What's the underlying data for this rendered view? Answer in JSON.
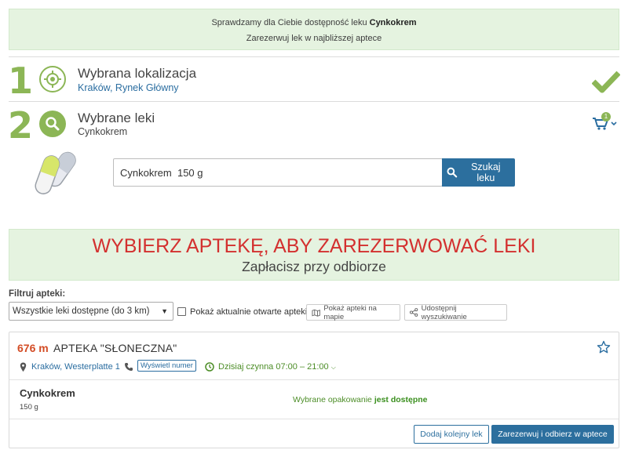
{
  "banner": {
    "line1_prefix": "Sprawdzamy dla Ciebie dostępność leku ",
    "line1_drug": "Cynkokrem",
    "line2": "Zarezerwuj lek w najbliższej aptece"
  },
  "steps": [
    {
      "number": "1",
      "title": "Wybrana lokalizacja",
      "subtitle": "Kraków, Rynek Główny",
      "icon": "crosshair-icon",
      "status_icon": "checkmark-icon"
    },
    {
      "number": "2",
      "title": "Wybrane leki",
      "subtitle": "Cynkokrem",
      "icon": "search-icon",
      "status_icon": "cart-icon",
      "cart_count": "1"
    }
  ],
  "search": {
    "value": "Cynkokrem  150 g",
    "button_label": "Szukaj leku"
  },
  "cta": {
    "headline": "WYBIERZ APTEKĘ, ABY ZAREZERWOWAĆ LEKI",
    "subline": "Zapłacisz przy odbiorze"
  },
  "filters": {
    "label": "Filtruj apteki:",
    "select_value": "Wszystkie leki dostępne (do 3 km)",
    "checkbox_label": "Pokaż aktualnie otwarte apteki",
    "map_button": "Pokaż apteki na mapie",
    "share_button": "Udostępnij wyszukiwanie"
  },
  "pharmacy": {
    "distance": "676 m",
    "name": "APTEKA \"SŁONECZNA\"",
    "address": "Kraków, Westerplatte 1",
    "phone_button": "Wyświetl numer",
    "hours": "Dzisiaj czynna 07:00 – 21:00",
    "drug": {
      "name": "Cynkokrem",
      "size": "150 g"
    },
    "availability_prefix": "Wybrane opakowanie ",
    "availability_status": "jest dostępne",
    "add_button": "Dodaj kolejny lek",
    "reserve_button": "Zarezerwuj i odbierz w aptece"
  },
  "colors": {
    "accent": "#2c6f9e",
    "brand_green": "#8cb656",
    "alert_red": "#d3302f",
    "distance": "#d34c25"
  }
}
